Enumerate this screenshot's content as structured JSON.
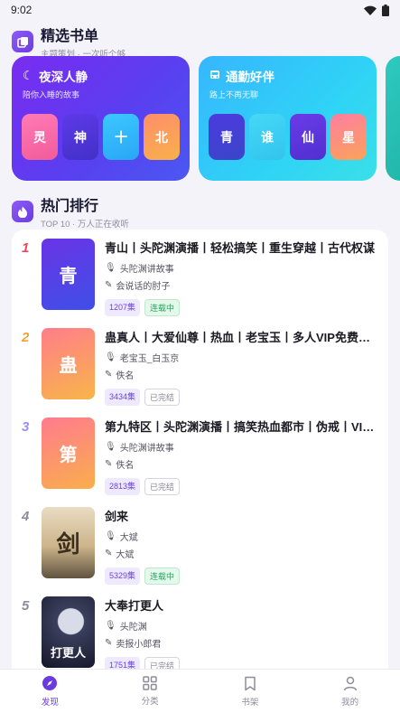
{
  "status": {
    "time": "9:02"
  },
  "featured": {
    "title": "精选书单",
    "subtitle": "主题策划 · 一次听个够",
    "cards": [
      {
        "title": "夜深人静",
        "subtitle": "陪你入睡的故事",
        "icon": "moon-icon",
        "tiles": [
          "灵",
          "神",
          "十",
          "北"
        ]
      },
      {
        "title": "通勤好伴",
        "subtitle": "路上不再无聊",
        "icon": "bus-icon",
        "tiles": [
          "青",
          "谁",
          "仙",
          "星"
        ]
      }
    ]
  },
  "ranking": {
    "title": "热门排行",
    "subtitle": "TOP 10 · 万人正在收听",
    "items": [
      {
        "rank": "1",
        "cover": "青",
        "title": "青山丨头陀渊演播丨轻松搞笑丨重生穿越丨古代权谋",
        "narrator": "头陀渊讲故事",
        "author": "会说话的肘子",
        "episodes": "1207集",
        "status": "连载中",
        "rank_color": "#e8485a"
      },
      {
        "rank": "2",
        "cover": "蛊",
        "title": "蛊真人丨大爱仙尊丨热血丨老宝玉丨多人VIP免费有声书",
        "narrator": "老宝玉_白玉京",
        "author": "佚名",
        "episodes": "3434集",
        "status": "已完结",
        "rank_color": "#f0a03a"
      },
      {
        "rank": "3",
        "cover": "第",
        "title": "第九特区丨头陀渊演播丨搞笑热血都市丨伪戒丨VIP免费",
        "narrator": "头陀渊讲故事",
        "author": "佚名",
        "episodes": "2813集",
        "status": "已完结",
        "rank_color": "#9d8ff0"
      },
      {
        "rank": "4",
        "cover": "剑",
        "title": "剑来",
        "narrator": "大斌",
        "author": "大斌",
        "episodes": "5329集",
        "status": "连载中",
        "rank_color": "#8e8b9a"
      },
      {
        "rank": "5",
        "cover": "打更人",
        "title": "大奉打更人",
        "narrator": "头陀渊",
        "author": "卖报小郎君",
        "episodes": "1751集",
        "status": "已完结",
        "rank_color": "#8e8b9a"
      }
    ]
  },
  "tabs": [
    {
      "label": "发现",
      "icon": "compass-icon"
    },
    {
      "label": "分类",
      "icon": "grid-icon"
    },
    {
      "label": "书架",
      "icon": "bookmark-icon"
    },
    {
      "label": "我的",
      "icon": "person-icon"
    }
  ]
}
